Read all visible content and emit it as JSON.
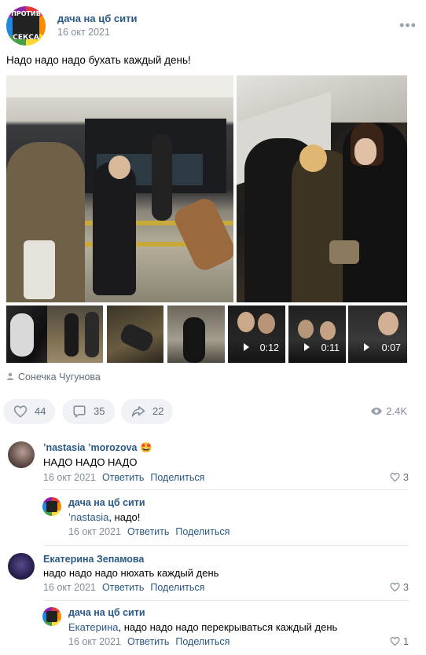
{
  "post": {
    "group_name": "дача на цб сити",
    "date": "16 окт 2021",
    "avatar_text_top": "ПРОТИВ",
    "avatar_text_bottom": "СЕКСА",
    "text": "Надо надо надо бухать каждый день!",
    "author": "Сонечка Чугунова"
  },
  "videos": [
    {
      "duration": "0:12"
    },
    {
      "duration": "0:11"
    },
    {
      "duration": "0:07"
    }
  ],
  "actions": {
    "likes": "44",
    "comments": "35",
    "shares": "22",
    "views": "2.4K"
  },
  "comments": [
    {
      "name": "ʼnastasia ʼmorozova",
      "emoji": "🤩",
      "text": "НАДО НАДО НАДО",
      "date": "16 окт 2021",
      "reply": "Ответить",
      "share": "Поделиться",
      "likes": "3"
    },
    {
      "name": "дача на цб сити",
      "mention": "ʼnastasia",
      "text": ", надо!",
      "date": "16 окт 2021",
      "reply": "Ответить",
      "share": "Поделиться"
    },
    {
      "name": "Екатерина Зепамова",
      "text": "надо надо надо нюхать каждый день",
      "date": "16 окт 2021",
      "reply": "Ответить",
      "share": "Поделиться",
      "likes": "3"
    },
    {
      "name": "дача на цб сити",
      "mention": "Екатерина",
      "text": ", надо надо надо перекрываться каждый день",
      "date": "16 окт 2021",
      "reply": "Ответить",
      "share": "Поделиться",
      "likes": "1"
    }
  ],
  "colors": {
    "link": "#2a5885",
    "muted": "#818c99",
    "pill_bg": "#f0f2f5"
  }
}
